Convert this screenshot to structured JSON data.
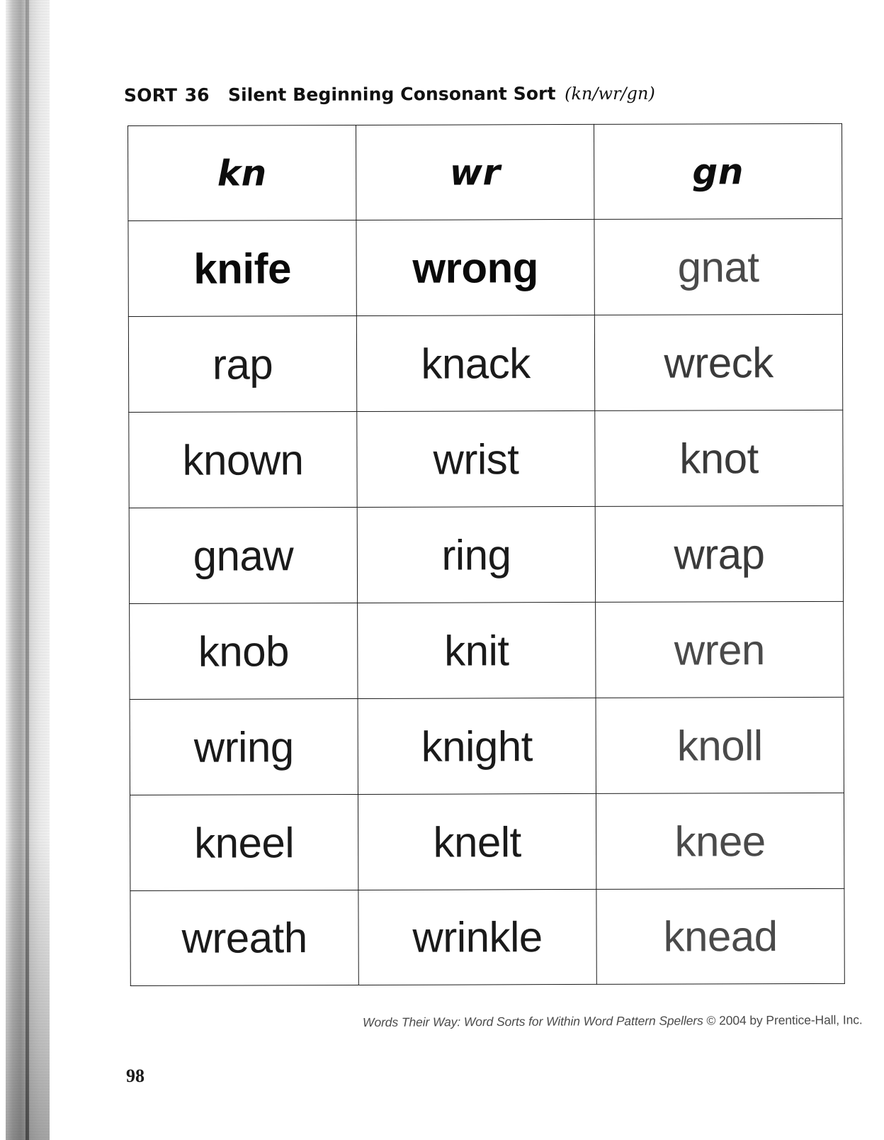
{
  "document": {
    "page_number": "98",
    "credit_italic": "Words Their Way: Word Sorts for Within Word Pattern Spellers",
    "credit_roman": " © 2004 by Prentice-Hall, Inc."
  },
  "header": {
    "sort_label": "SORT",
    "sort_number": "36",
    "description": "Silent Beginning Consonant Sort",
    "patterns": "(kn/wr/gn)"
  },
  "sort_table": {
    "columns": [
      "kn",
      "wr",
      "gn"
    ],
    "rows": [
      [
        "knife",
        "wrong",
        "gnat"
      ],
      [
        "rap",
        "knack",
        "wreck"
      ],
      [
        "known",
        "wrist",
        "knot"
      ],
      [
        "gnaw",
        "ring",
        "wrap"
      ],
      [
        "knob",
        "knit",
        "wren"
      ],
      [
        "wring",
        "knight",
        "knoll"
      ],
      [
        "kneel",
        "knelt",
        "knee"
      ],
      [
        "wreath",
        "wrinkle",
        "knead"
      ]
    ]
  }
}
